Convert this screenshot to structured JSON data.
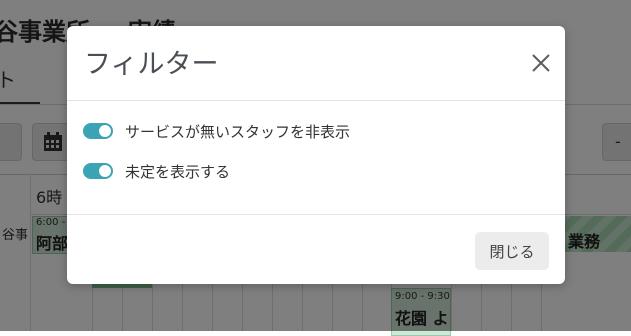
{
  "background": {
    "title_left": "谷事業所",
    "title_right": "実績",
    "tab_label": "ト",
    "right_button_label": "-",
    "hour_label": "6時",
    "row_label": "谷事",
    "events": [
      {
        "time": "6:00 -",
        "name": "阿部"
      },
      {
        "time": "",
        "name": "業務"
      },
      {
        "time": "9:00 - 9:30",
        "name": "花園 よ"
      }
    ]
  },
  "modal": {
    "title": "フィルター",
    "toggles": [
      {
        "label": "サービスが無いスタッフを非表示",
        "checked": true
      },
      {
        "label": "未定を表示する",
        "checked": true
      }
    ],
    "close_button_label": "閉じる"
  },
  "colors": {
    "toggle_on": "#3aa3b4",
    "overlay": "rgba(0,0,0,0.5)"
  },
  "icons": {
    "close": "close-icon",
    "calendar": "calendar-icon"
  }
}
